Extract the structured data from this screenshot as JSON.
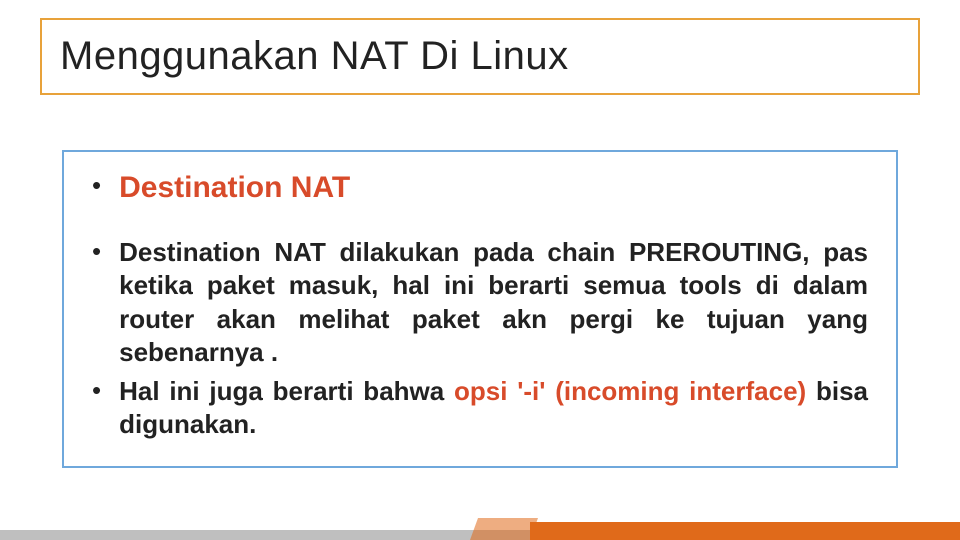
{
  "title": "Menggunakan NAT Di Linux",
  "bullet1": "Destination NAT",
  "bullet2_a": "Destination NAT dilakukan pada chain PREROUTING, pas ketika paket masuk, hal ini berarti semua tools di dalam router akan melihat paket akn pergi ke tujuan yang sebenarnya .",
  "bullet3_a": "Hal ini juga berarti bahwa ",
  "bullet3_b": "opsi '-i' (incoming interface)",
  "bullet3_c": " bisa digunakan."
}
